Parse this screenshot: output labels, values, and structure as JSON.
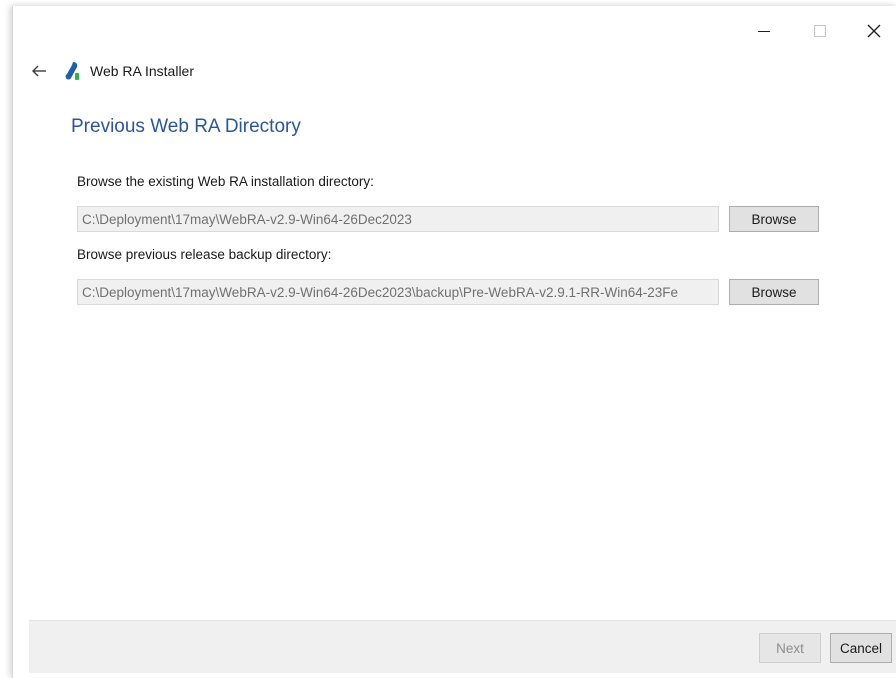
{
  "window": {
    "minimize_icon": "minimize-icon",
    "maximize_icon": "maximize-icon",
    "close_icon": "close-icon"
  },
  "header": {
    "back_icon": "back-arrow-icon",
    "app_icon": "app-logo-icon",
    "app_title": "Web RA Installer"
  },
  "page": {
    "title": "Previous Web RA Directory"
  },
  "fields": [
    {
      "label": "Browse the existing Web RA installation directory:",
      "value": "C:\\Deployment\\17may\\WebRA-v2.9-Win64-26Dec2023",
      "button_label": "Browse"
    },
    {
      "label": "Browse previous release backup directory:",
      "value": "C:\\Deployment\\17may\\WebRA-v2.9-Win64-26Dec2023\\backup\\Pre-WebRA-v2.9.1-RR-Win64-23Fe",
      "button_label": "Browse"
    }
  ],
  "footer": {
    "next_label": "Next",
    "cancel_label": "Cancel"
  },
  "colors": {
    "title_blue": "#2b579a",
    "logo_blue": "#1f5fa8",
    "logo_green": "#2fb24a"
  }
}
